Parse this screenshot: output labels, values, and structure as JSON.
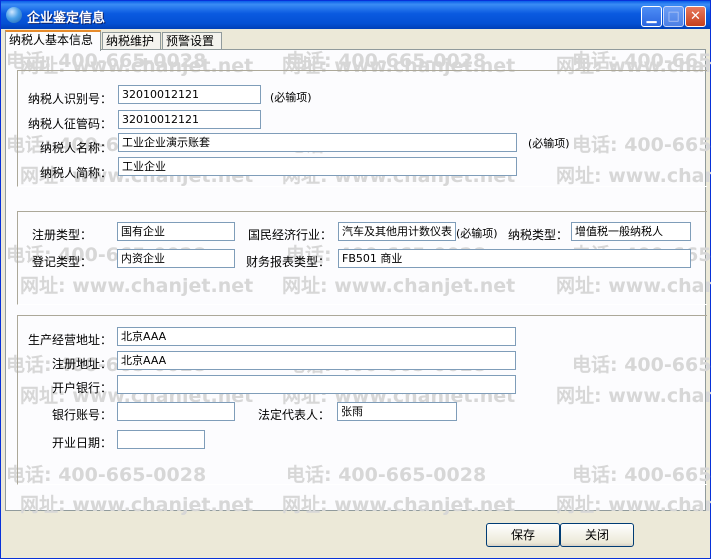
{
  "window": {
    "title": "企业鉴定信息"
  },
  "tabs": [
    {
      "label": "纳税人基本信息"
    },
    {
      "label": "纳税维护"
    },
    {
      "label": "预警设置"
    }
  ],
  "watermark": {
    "phone": "电话: 400-665-0028",
    "site": "网址: www.chanjet.net"
  },
  "group1": {
    "taxpayer_id_label": "纳税人识别号：",
    "taxpayer_id_value": "32010012121",
    "required_1": "(必输项)",
    "tax_mgmt_code_label": "纳税人征管码：",
    "tax_mgmt_code_value": "32010012121",
    "taxpayer_name_label": "纳税人名称：",
    "taxpayer_name_value": "工业企业演示账套",
    "required_2": "(必输项)",
    "taxpayer_short_label": "纳税人简称：",
    "taxpayer_short_value": "工业企业"
  },
  "group2": {
    "reg_type_label": "注册类型：",
    "reg_type_value": "国有企业",
    "industry_label": "国民经济行业：",
    "industry_value": "汽车及其他用计数仪表",
    "required_3": "(必输项)",
    "tax_type_label": "纳税类型：",
    "tax_type_value": "增值税一般纳税人",
    "record_type_label": "登记类型：",
    "record_type_value": "内资企业",
    "fin_report_label": "财务报表类型：",
    "fin_report_value": "FB501 商业"
  },
  "group3": {
    "biz_address_label": "生产经营地址：",
    "biz_address_value": "北京AAA",
    "reg_address_label": "注册地址：",
    "reg_address_value": "北京AAA",
    "bank_label": "开户银行：",
    "bank_value": "",
    "account_label": "银行账号：",
    "account_value": "",
    "legal_rep_label": "法定代表人：",
    "legal_rep_value": "张雨",
    "open_date_label": "开业日期：",
    "open_date_value": ""
  },
  "buttons": {
    "save": "保存",
    "close": "关闭"
  }
}
